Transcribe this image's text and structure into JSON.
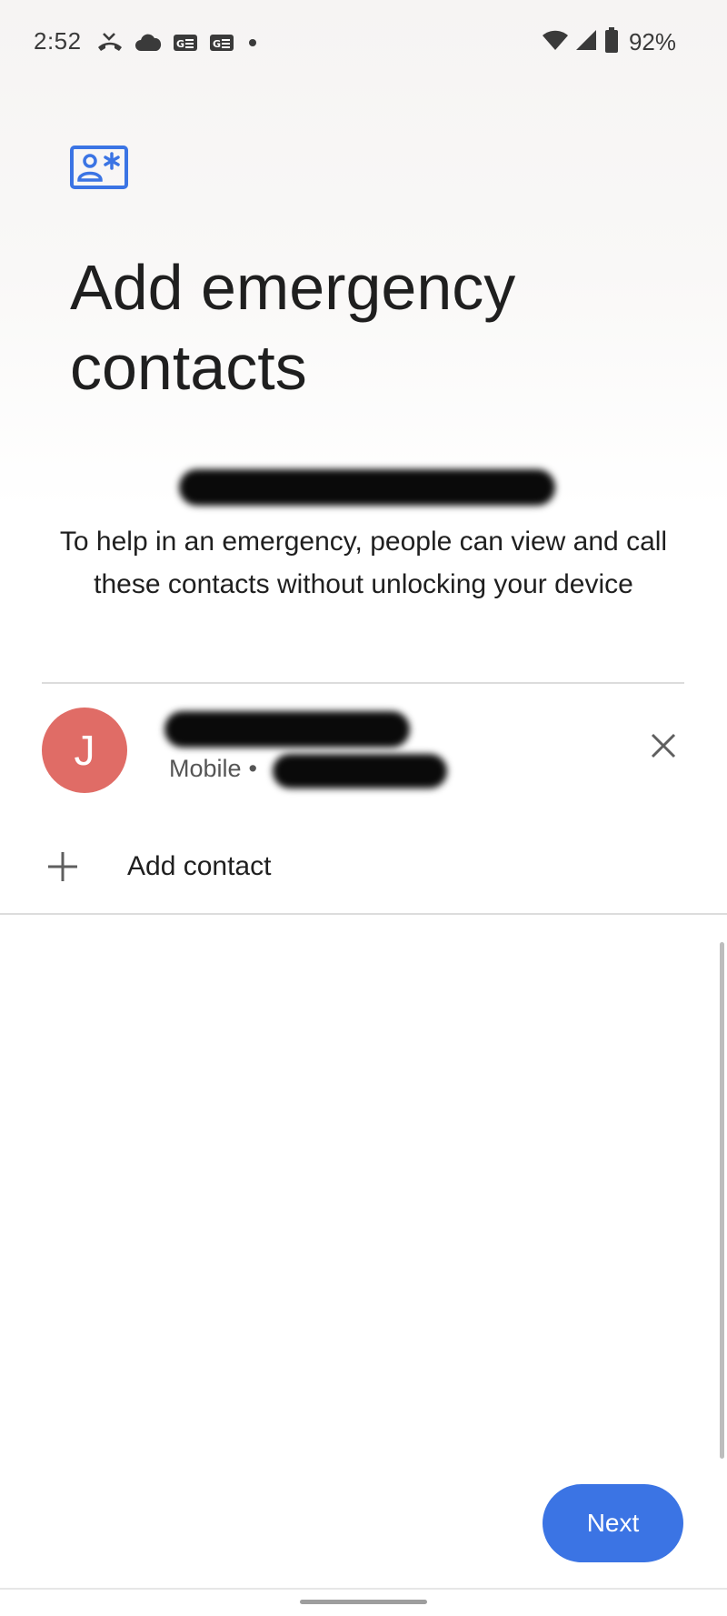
{
  "status_bar": {
    "time": "2:52",
    "battery_percent": "92%",
    "icons_left": [
      "missed-call-icon",
      "cloud-icon",
      "ge-badge-icon",
      "ge-badge-icon",
      "dot-icon"
    ],
    "icons_right": [
      "wifi-icon",
      "cell-signal-icon",
      "battery-icon"
    ]
  },
  "header": {
    "icon": "contact-card-asterisk-icon",
    "title": "Add emergency contacts",
    "accent_color": "#3b74e4"
  },
  "description": "To help in an emergency, people can view and call these contacts without unlocking your device",
  "contacts": [
    {
      "initial": "J",
      "type": "Mobile",
      "separator": "•",
      "avatar_color": "#e06c66"
    }
  ],
  "add_contact": {
    "label": "Add contact"
  },
  "next_button": {
    "label": "Next"
  }
}
